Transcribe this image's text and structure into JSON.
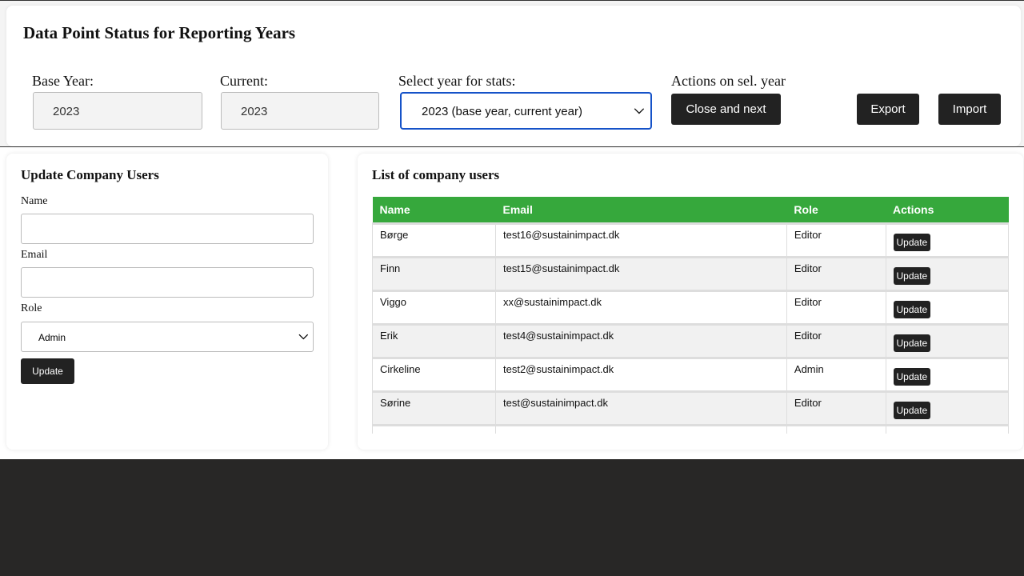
{
  "header": {
    "title": "Data Point Status for Reporting Years",
    "base_year_label": "Base Year:",
    "base_year_value": "2023",
    "current_label": "Current:",
    "current_value": "2023",
    "select_label": "Select year for stats:",
    "select_value": "2023 (base year, current year)",
    "actions_label": "Actions on sel. year",
    "close_next": "Close and next",
    "export": "Export",
    "import": "Import"
  },
  "update_form": {
    "title": "Update Company Users",
    "name_label": "Name",
    "name_value": "",
    "email_label": "Email",
    "email_value": "",
    "role_label": "Role",
    "role_value": "Admin",
    "submit": "Update"
  },
  "users": {
    "title": "List of company users",
    "columns": [
      "Name",
      "Email",
      "Role",
      "Actions"
    ],
    "action_label": "Update",
    "rows": [
      {
        "name": "Børge",
        "email": "test16@sustainimpact.dk",
        "role": "Editor"
      },
      {
        "name": "Finn",
        "email": "test15@sustainimpact.dk",
        "role": "Editor"
      },
      {
        "name": "Viggo",
        "email": "xx@sustainimpact.dk",
        "role": "Editor"
      },
      {
        "name": "Erik",
        "email": "test4@sustainimpact.dk",
        "role": "Editor"
      },
      {
        "name": "Cirkeline",
        "email": "test2@sustainimpact.dk",
        "role": "Admin"
      },
      {
        "name": "Sørine",
        "email": "test@sustainimpact.dk",
        "role": "Editor"
      }
    ]
  },
  "colors": {
    "table_header": "#36a83c",
    "button": "#222222",
    "focus": "#1552c8"
  }
}
